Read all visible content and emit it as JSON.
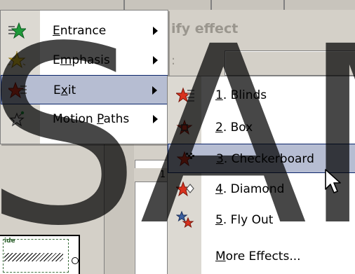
{
  "background": {
    "panel_title": "ify effect",
    "colon": ":",
    "row_number": "1",
    "slide_label": "ide"
  },
  "main_menu": {
    "items": [
      {
        "pre": "",
        "key": "E",
        "post": "ntrance",
        "icon": "entrance-effect-icon",
        "has_submenu": true,
        "selected": false
      },
      {
        "pre": "E",
        "key": "m",
        "post": "phasis",
        "icon": "emphasis-effect-icon",
        "has_submenu": true,
        "selected": false
      },
      {
        "pre": "E",
        "key": "x",
        "post": "it",
        "icon": "exit-effect-icon",
        "has_submenu": true,
        "selected": true
      },
      {
        "pre": "Motion ",
        "key": "P",
        "post": "aths",
        "icon": "motion-paths-icon",
        "has_submenu": true,
        "selected": false
      }
    ]
  },
  "exit_submenu": {
    "items": [
      {
        "pre": "",
        "key": "1",
        "post": ". Blinds",
        "icon": "blinds-exit-icon",
        "selected": false
      },
      {
        "pre": "",
        "key": "2",
        "post": ". Box",
        "icon": "box-exit-icon",
        "selected": false
      },
      {
        "pre": "",
        "key": "3",
        "post": ". Checkerboard",
        "icon": "checkerboard-exit-icon",
        "selected": true
      },
      {
        "pre": "",
        "key": "4",
        "post": ". Diamond",
        "icon": "diamond-exit-icon",
        "selected": false
      },
      {
        "pre": "",
        "key": "5",
        "post": ". Fly Out",
        "icon": "fly-out-exit-icon",
        "selected": false
      },
      {
        "pre": "",
        "key": "M",
        "post": "ore Effects...",
        "icon": "",
        "selected": false
      }
    ]
  },
  "watermark": "SAM",
  "colors": {
    "selection_fill": "#b6bdd2",
    "selection_border": "#0a246a",
    "menu_gutter": "#dcd9d2",
    "entrance_star": "#1f9a3a",
    "emphasis_star": "#e8c21a",
    "exit_star": "#d9321e"
  }
}
